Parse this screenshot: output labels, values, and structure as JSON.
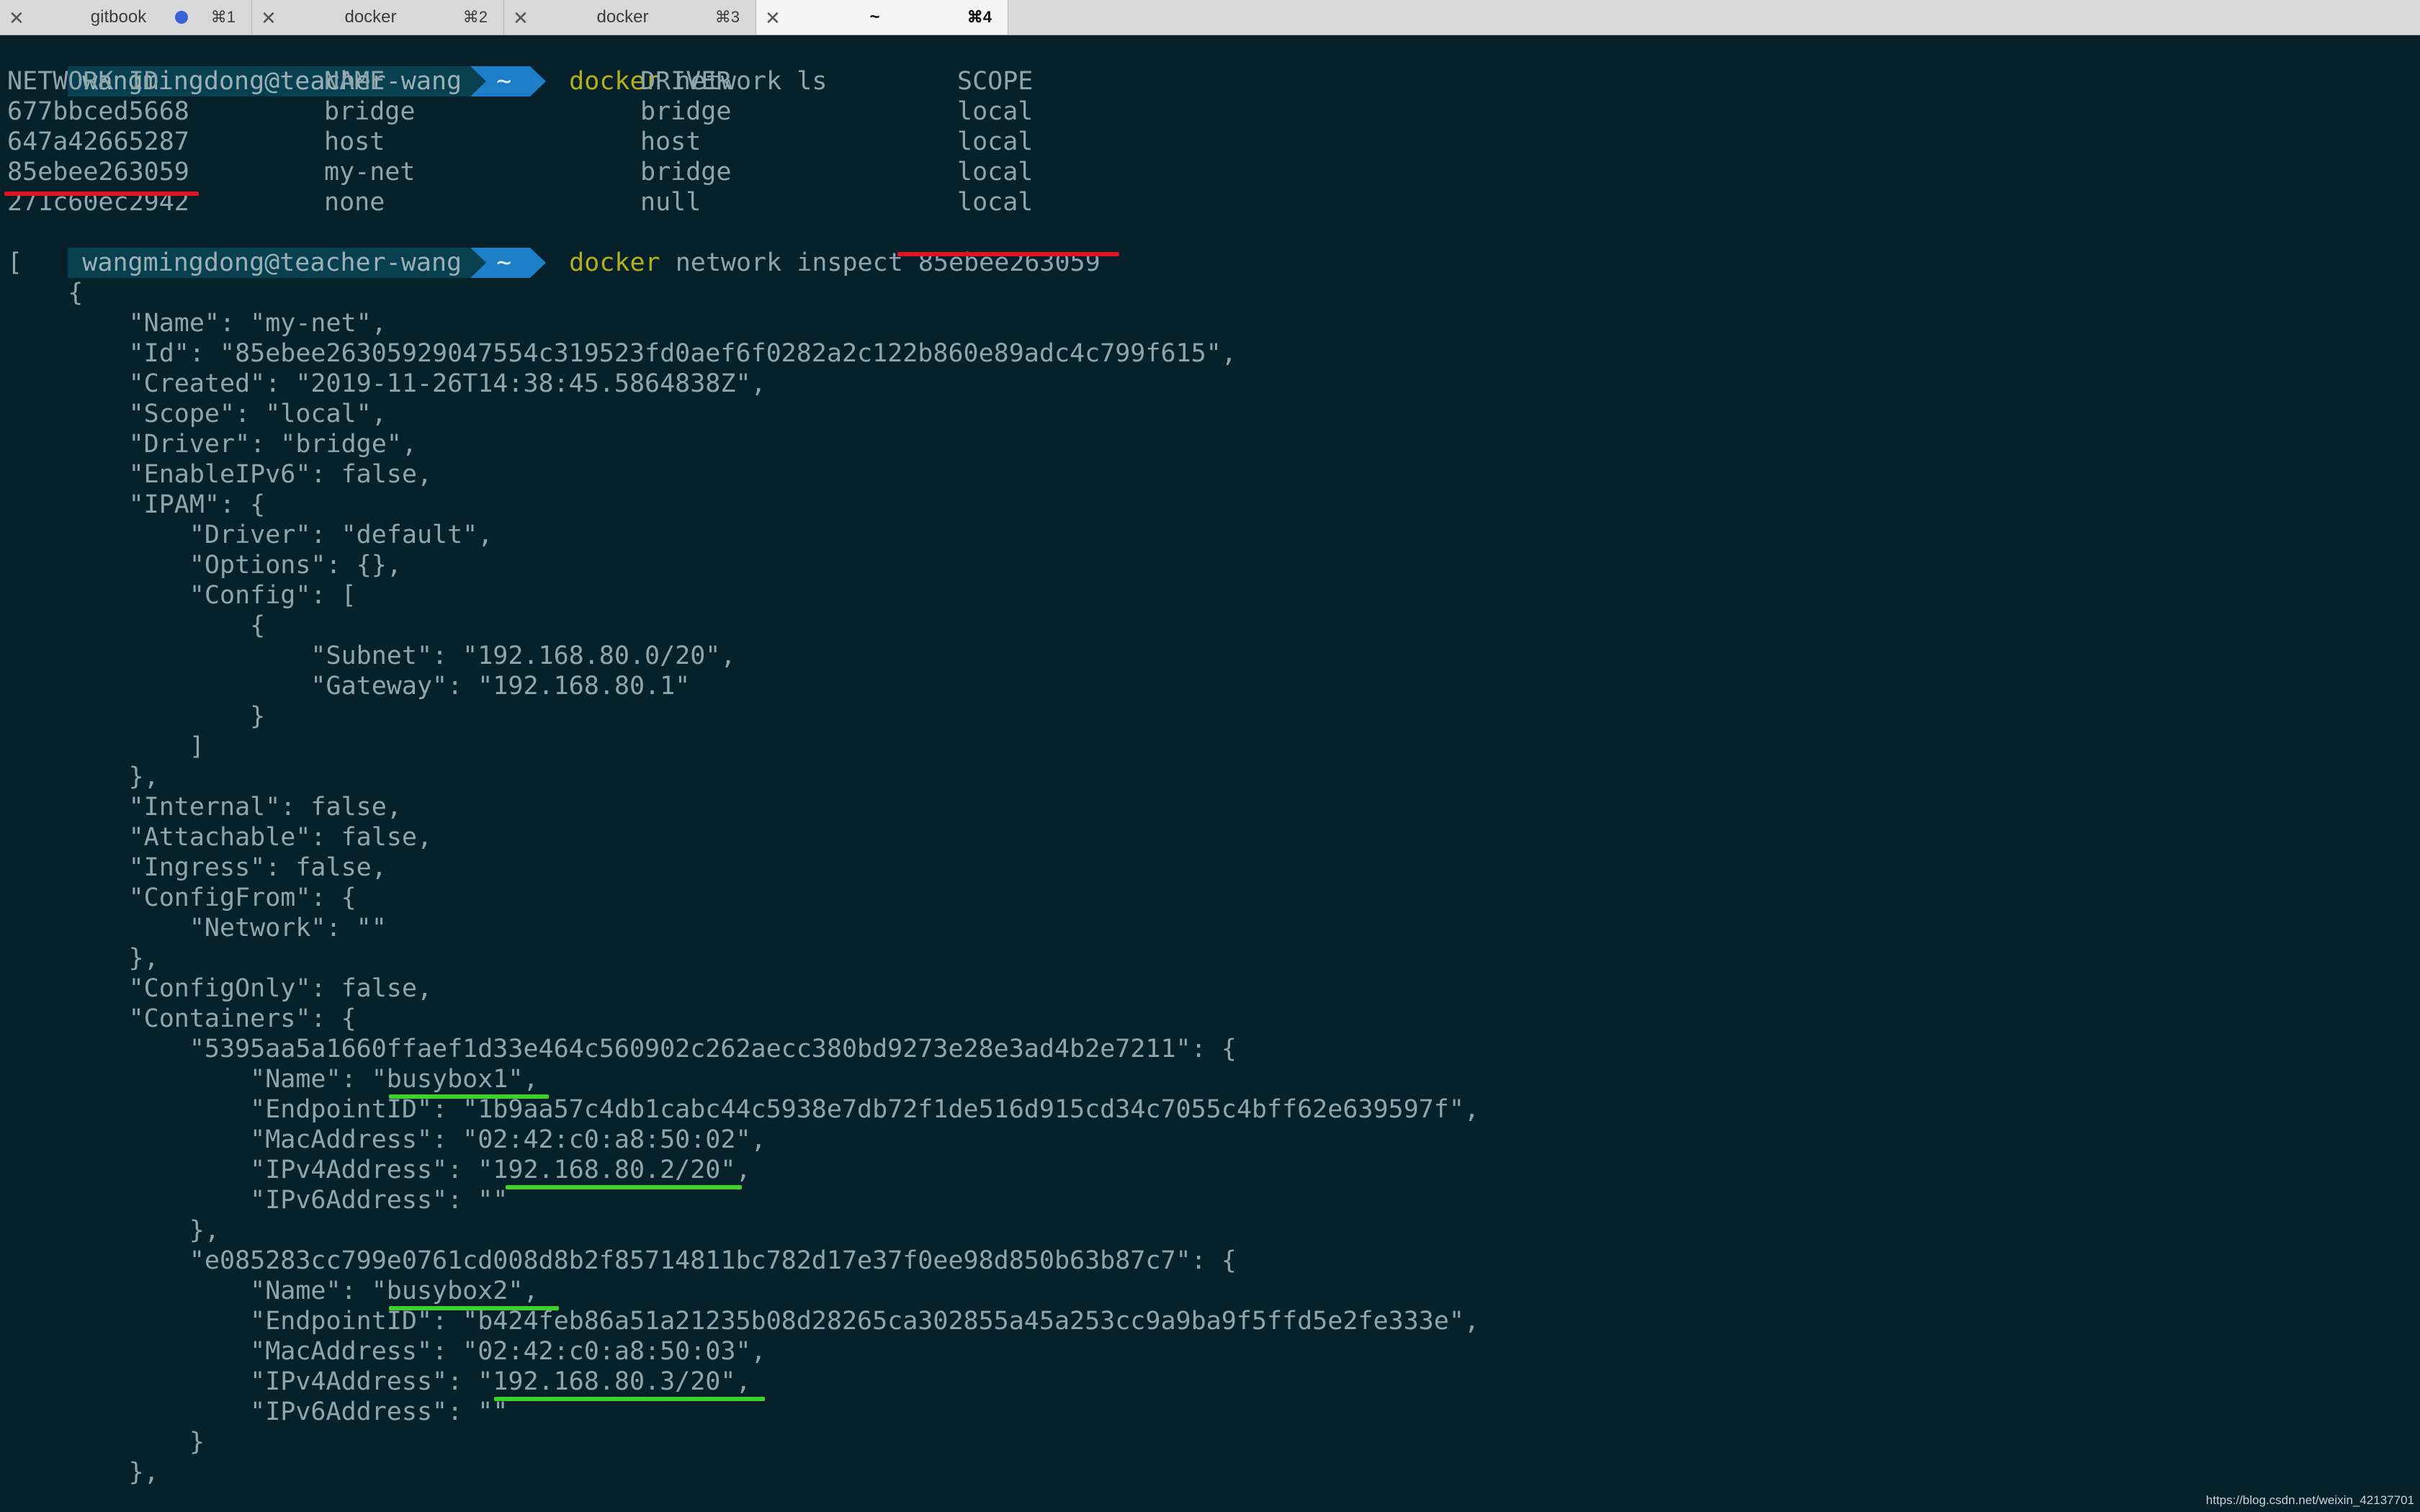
{
  "tabs": [
    {
      "title": "gitbook",
      "key": "⌘1",
      "has_dot": true
    },
    {
      "title": "docker",
      "key": "⌘2"
    },
    {
      "title": "docker",
      "key": "⌘3"
    },
    {
      "title": "~",
      "key": "⌘4",
      "active": true
    }
  ],
  "colors": {
    "background": "#06212a",
    "text": "#8ea5ae",
    "command": "#b4b01a",
    "prompt_host_bg": "#094050",
    "prompt_dir_bg": "#1c7fc8",
    "highlight_red": "#e0141e",
    "highlight_green": "#3ed12e"
  },
  "prompt": {
    "host": "wangmingdong@teacher-wang",
    "dir": "~"
  },
  "commands": [
    {
      "tool": "docker",
      "args": "network ls"
    },
    {
      "tool": "docker",
      "args": "network inspect 85ebee263059"
    }
  ],
  "network_table": {
    "headers": [
      "NETWORK ID",
      "NAME",
      "DRIVER",
      "SCOPE"
    ],
    "rows": [
      [
        "677bbced5668",
        "bridge",
        "bridge",
        "local"
      ],
      [
        "647a42665287",
        "host",
        "host",
        "local"
      ],
      [
        "85ebee263059",
        "my-net",
        "bridge",
        "local"
      ],
      [
        "271c60ec2942",
        "none",
        "null",
        "local"
      ]
    ]
  },
  "inspect_output": [
    "[",
    "    {",
    "        \"Name\": \"my-net\",",
    "        \"Id\": \"85ebee26305929047554c319523fd0aef6f0282a2c122b860e89adc4c799f615\",",
    "        \"Created\": \"2019-11-26T14:38:45.5864838Z\",",
    "        \"Scope\": \"local\",",
    "        \"Driver\": \"bridge\",",
    "        \"EnableIPv6\": false,",
    "        \"IPAM\": {",
    "            \"Driver\": \"default\",",
    "            \"Options\": {},",
    "            \"Config\": [",
    "                {",
    "                    \"Subnet\": \"192.168.80.0/20\",",
    "                    \"Gateway\": \"192.168.80.1\"",
    "                }",
    "            ]",
    "        },",
    "        \"Internal\": false,",
    "        \"Attachable\": false,",
    "        \"Ingress\": false,",
    "        \"ConfigFrom\": {",
    "            \"Network\": \"\"",
    "        },",
    "        \"ConfigOnly\": false,",
    "        \"Containers\": {",
    "            \"5395aa5a1660ffaef1d33e464c560902c262aecc380bd9273e28e3ad4b2e7211\": {",
    "                \"Name\": \"busybox1\",",
    "                \"EndpointID\": \"1b9aa57c4db1cabc44c5938e7db72f1de516d915cd34c7055c4bff62e639597f\",",
    "                \"MacAddress\": \"02:42:c0:a8:50:02\",",
    "                \"IPv4Address\": \"192.168.80.2/20\",",
    "                \"IPv6Address\": \"\"",
    "            },",
    "            \"e085283cc799e0761cd008d8b2f85714811bc782d17e37f0ee98d850b63b87c7\": {",
    "                \"Name\": \"busybox2\",",
    "                \"EndpointID\": \"b424feb86a51a21235b08d28265ca302855a45a253cc9a9ba9f5ffd5e2fe333e\",",
    "                \"MacAddress\": \"02:42:c0:a8:50:03\",",
    "                \"IPv4Address\": \"192.168.80.3/20\",",
    "                \"IPv6Address\": \"\"",
    "            }",
    "        },"
  ],
  "watermark": "https://blog.csdn.net/weixin_42137701"
}
